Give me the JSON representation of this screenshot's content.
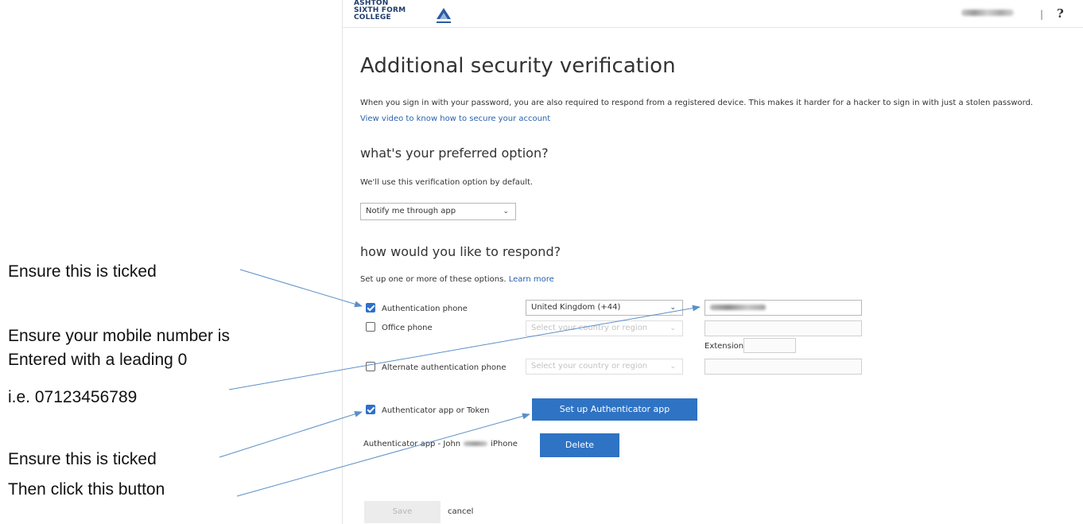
{
  "header": {
    "logo_lines": [
      "ASHTON",
      "SIXTH FORM",
      "COLLEGE"
    ],
    "separator": "|",
    "help": "?"
  },
  "title": "Additional security verification",
  "intro": {
    "text": "When you sign in with your password, you are also required to respond from a registered device. This makes it harder for a hacker to sign in with just a stolen password.",
    "link": "View video to know how to secure your account"
  },
  "preferred": {
    "heading": "what's your preferred option?",
    "sub": "We'll use this verification option by default.",
    "selected": "Notify me through app"
  },
  "respond": {
    "heading": "how would you like to respond?",
    "sub": "Set up one or more of these options.",
    "learn_more": "Learn more"
  },
  "options": [
    {
      "label": "Authentication phone",
      "checked": true,
      "country": "United Kingdom (+44)"
    },
    {
      "label": "Office phone",
      "checked": false,
      "country": "Select your country or region",
      "extension_label": "Extension"
    },
    {
      "label": "Alternate authentication phone",
      "checked": false,
      "country": "Select your country or region"
    },
    {
      "label": "Authenticator app or Token",
      "checked": true,
      "button": "Set up Authenticator app"
    }
  ],
  "device": {
    "prefix": "Authenticator app - John",
    "suffix": "iPhone",
    "delete_label": "Delete"
  },
  "footer": {
    "save": "Save",
    "cancel": "cancel"
  },
  "annotations": {
    "a1": "Ensure this is ticked",
    "a2_l1": "Ensure your mobile number is",
    "a2_l2": "Entered with a leading 0",
    "a2_l3": "i.e. 07123456789",
    "a3": "Ensure this is ticked",
    "a4": "Then click this button"
  },
  "colors": {
    "accent": "#2f73c4",
    "arrow": "#5b8fc9",
    "link": "#2a62ad"
  }
}
